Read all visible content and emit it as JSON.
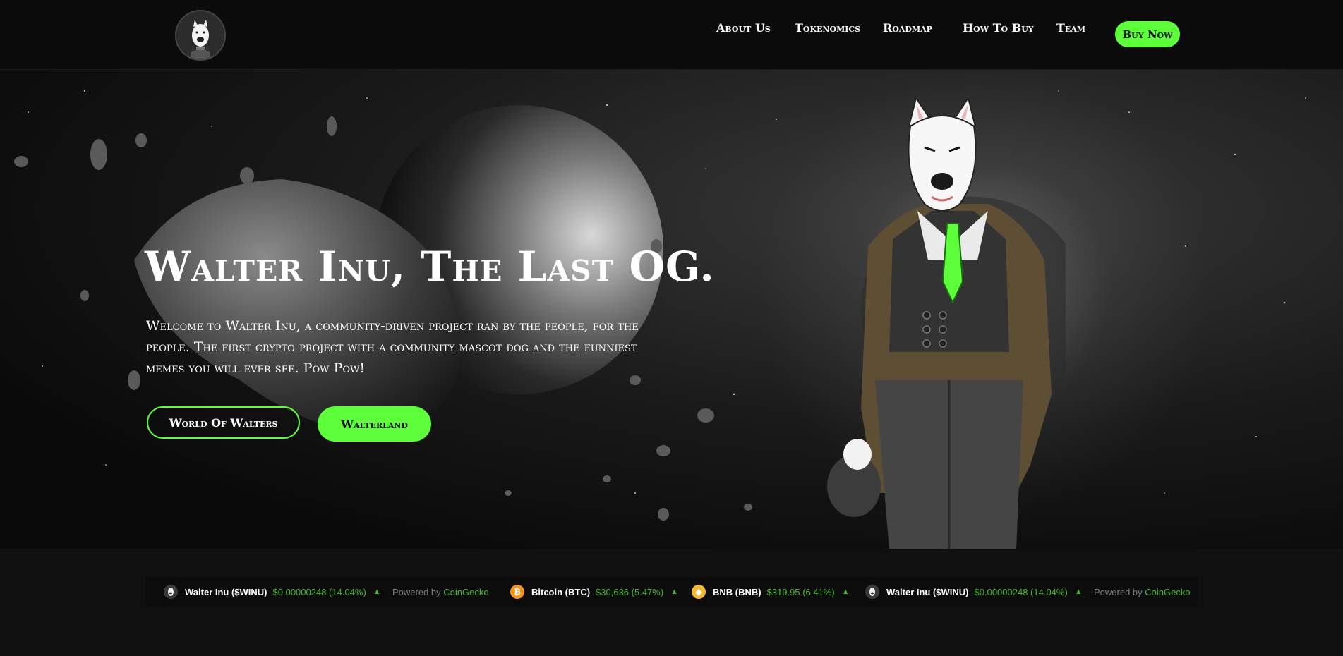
{
  "header": {
    "nav": [
      "About Us",
      "Tokenomics",
      "Roadmap",
      "How To Buy",
      "Team"
    ],
    "buy_now": "Buy Now"
  },
  "hero": {
    "title": "Walter Inu, The Last OG.",
    "description": "Welcome to Walter Inu, a community-driven project ran by the people, for the people. The first crypto project with a community mascot dog and the funniest memes you will ever see. Pow Pow!",
    "btn_world": "World Of Walters",
    "btn_walterland": "Walterland"
  },
  "ticker": {
    "items": [
      {
        "name": "Walter Inu ($WINU)",
        "price": "$0.00000248 (14.04%)",
        "icon": "walter-inu-icon"
      },
      {
        "name": "Bitcoin (BTC)",
        "price": "$30,636 (5.47%)",
        "icon": "bitcoin-icon"
      },
      {
        "name": "BNB (BNB)",
        "price": "$319.95 (6.41%)",
        "icon": "bnb-icon"
      },
      {
        "name": "Walter Inu ($WINU)",
        "price": "$0.00000248 (14.04%)",
        "icon": "walter-inu-icon"
      }
    ],
    "powered_by": "Powered by",
    "powered_link": "CoinGecko"
  },
  "colors": {
    "accent": "#5dff3a",
    "price_green": "#4ab82b",
    "header_bg": "#0b0b0b",
    "page_bg": "#101010"
  }
}
